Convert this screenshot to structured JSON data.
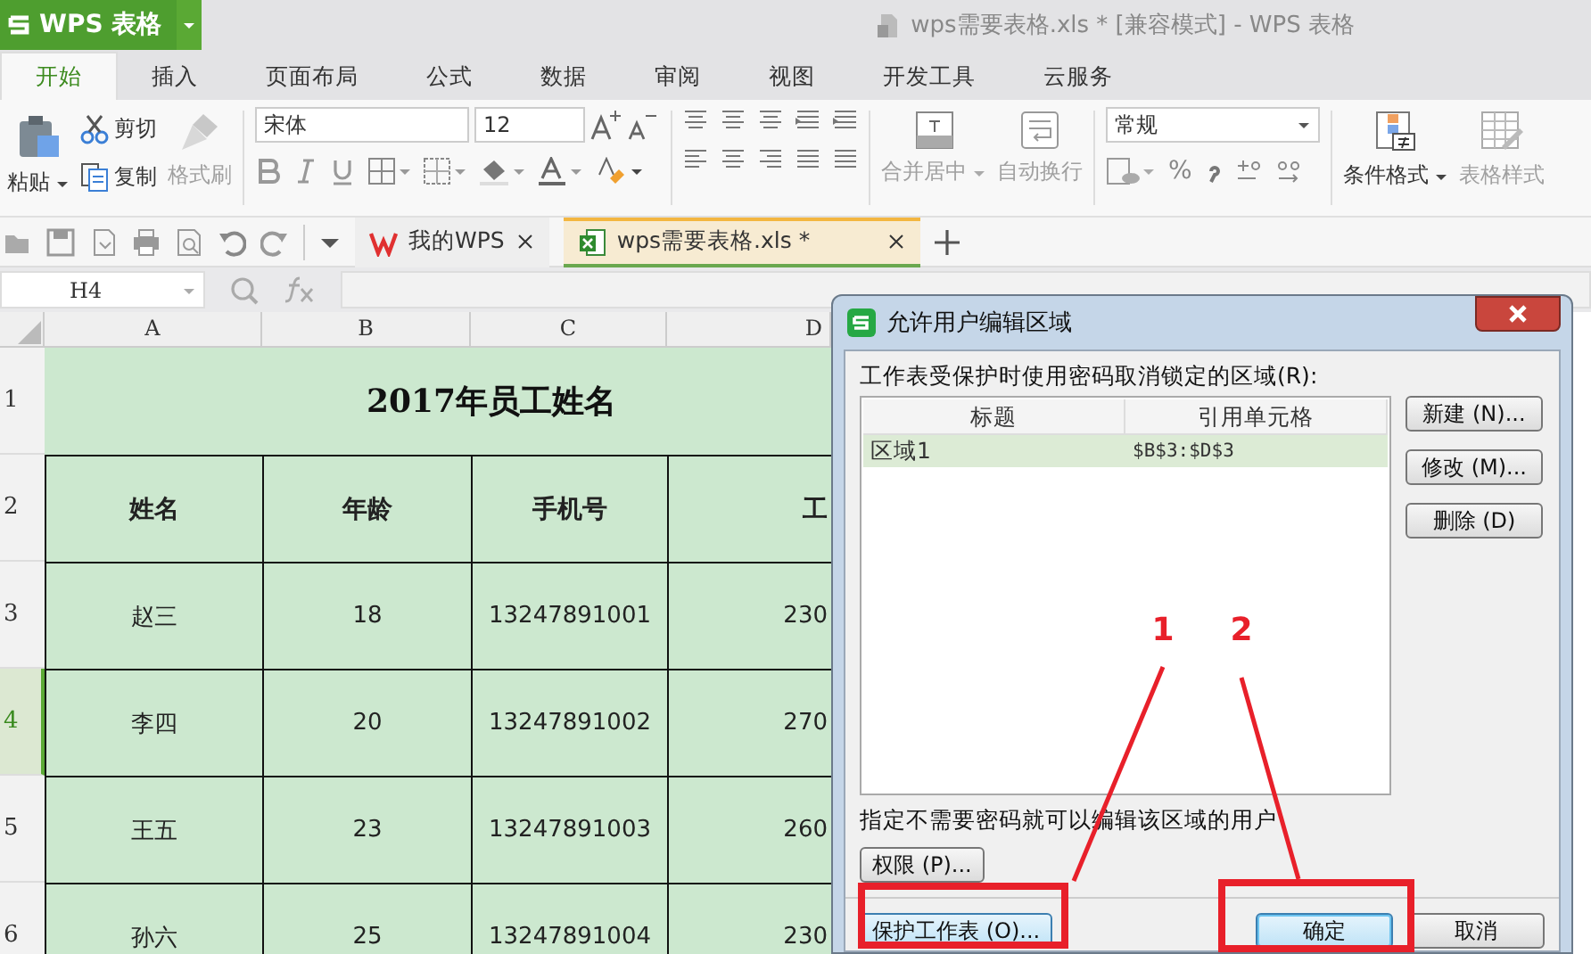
{
  "app_menu": {
    "label": "WPS 表格"
  },
  "window": {
    "title": "wps需要表格.xls * [兼容模式] - WPS 表格"
  },
  "ribbon_tabs": [
    {
      "label": "开始",
      "selected": true
    },
    {
      "label": "插入",
      "selected": false
    },
    {
      "label": "页面布局",
      "selected": false
    },
    {
      "label": "公式",
      "selected": false
    },
    {
      "label": "数据",
      "selected": false
    },
    {
      "label": "审阅",
      "selected": false
    },
    {
      "label": "视图",
      "selected": false
    },
    {
      "label": "开发工具",
      "selected": false
    },
    {
      "label": "云服务",
      "selected": false
    }
  ],
  "ribbon": {
    "paste": {
      "label": "粘贴",
      "disabled": false
    },
    "cut": {
      "label": "剪切",
      "disabled": false
    },
    "copy": {
      "label": "复制",
      "disabled": false
    },
    "format_painter": {
      "label": "格式刷",
      "disabled": true
    },
    "font": "宋体",
    "font_size": "12",
    "merge": {
      "label": "合并居中",
      "disabled": true
    },
    "wrap": {
      "label": "自动换行",
      "disabled": true
    },
    "number_format": "常规",
    "percent": "%",
    "conditional_format": {
      "label": "条件格式",
      "disabled": false
    },
    "table_style": {
      "label": "表格样式",
      "disabled": true
    }
  },
  "doc_tabs": [
    {
      "label": "我的WPS",
      "selected": false,
      "kind": "home"
    },
    {
      "label": "wps需要表格.xls *",
      "selected": true,
      "kind": "sheet"
    }
  ],
  "name_box": "H4",
  "sheet": {
    "columns": [
      "A",
      "B",
      "C",
      "D"
    ],
    "row_numbers": [
      {
        "label": "1",
        "selected": false
      },
      {
        "label": "2",
        "selected": false
      },
      {
        "label": "3",
        "selected": false
      },
      {
        "label": "4",
        "selected": true
      },
      {
        "label": "5",
        "selected": false
      },
      {
        "label": "6",
        "selected": false
      }
    ],
    "title": "2017年员工姓名",
    "header": [
      "姓名",
      "年龄",
      "手机号",
      "工"
    ],
    "rows": [
      [
        "赵三",
        "18",
        "13247891001",
        "230"
      ],
      [
        "李四",
        "20",
        "13247891002",
        "270"
      ],
      [
        "王五",
        "23",
        "13247891003",
        "260"
      ],
      [
        "孙六",
        "25",
        "13247891004",
        "230"
      ]
    ]
  },
  "dialog": {
    "title": "允许用户编辑区域",
    "ranges_label": "工作表受保护时使用密码取消锁定的区域(R):",
    "list": {
      "columns": [
        "标题",
        "引用单元格"
      ],
      "rows": [
        {
          "title": "区域1",
          "reference": "$B$3:$D$3",
          "selected": true
        }
      ]
    },
    "side_buttons": [
      "新建 (N)...",
      "修改 (M)...",
      "删除 (D)"
    ],
    "users_label": "指定不需要密码就可以编辑该区域的用户",
    "permissions_button": "权限 (P)...",
    "protect_button": "保护工作表 (O)...",
    "ok_button": {
      "label": "确定",
      "default": true
    },
    "cancel_button": "取消"
  },
  "annotations": [
    {
      "label": "1"
    },
    {
      "label": "2"
    }
  ]
}
